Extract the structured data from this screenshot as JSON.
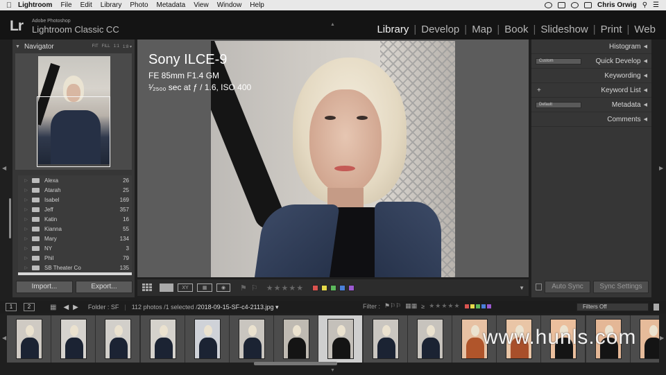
{
  "menubar": {
    "app": "Lightroom",
    "items": [
      "File",
      "Edit",
      "Library",
      "Photo",
      "Metadata",
      "View",
      "Window",
      "Help"
    ],
    "user": "Chris Orwig"
  },
  "identity": {
    "logo": "Lr",
    "vendor": "Adobe Photoshop",
    "product": "Lightroom Classic CC"
  },
  "modules": [
    "Library",
    "Develop",
    "Map",
    "Book",
    "Slideshow",
    "Print",
    "Web"
  ],
  "active_module": "Library",
  "navigator": {
    "title": "Navigator",
    "zoom_options": [
      "FIT",
      "FILL",
      "1:1",
      "1:8 ▾"
    ]
  },
  "folders": [
    {
      "name": "Alexa",
      "count": "26"
    },
    {
      "name": "Atarah",
      "count": "25"
    },
    {
      "name": "Isabel",
      "count": "169"
    },
    {
      "name": "Jeff",
      "count": "357"
    },
    {
      "name": "Katin",
      "count": "16"
    },
    {
      "name": "Kianna",
      "count": "55"
    },
    {
      "name": "Mary",
      "count": "134"
    },
    {
      "name": "NY",
      "count": "3"
    },
    {
      "name": "Phil",
      "count": "79"
    },
    {
      "name": "SB Theater Co",
      "count": "135"
    },
    {
      "name": "SF",
      "count": "112"
    }
  ],
  "left_buttons": {
    "import": "Import...",
    "export": "Export..."
  },
  "right_panel": {
    "histogram": "Histogram",
    "quick_develop": "Quick Develop",
    "quick_develop_preset": "Custom",
    "keywording": "Keywording",
    "keyword_list": "Keyword List",
    "metadata": "Metadata",
    "metadata_preset": "Default",
    "comments": "Comments",
    "auto_sync": "Auto Sync",
    "sync_settings": "Sync Settings"
  },
  "photo_info": {
    "camera": "Sony ILCE-9",
    "lens": "FE 85mm F1.4 GM",
    "exposure": "¹⁄₂₅₀₀ sec at ƒ / 1.6, ISO 400"
  },
  "toolbar": {
    "stars": "★★★★★",
    "color_labels": [
      "#d9534f",
      "#e6d94a",
      "#5cb85c",
      "#4a7fd9",
      "#9b59d0"
    ]
  },
  "filmstrip_bar": {
    "view1": "1",
    "view2": "2",
    "folder": "Folder : SF",
    "count_text": "112 photos /1 selected /",
    "filename": "2018-09-15-SF-c4-2113.jpg ▾",
    "filter_label": "Filter :",
    "filters_off": "Filters Off"
  },
  "filmstrip": {
    "count_visible": 15,
    "selected_index": 7
  },
  "watermark": "www.hunls.com"
}
